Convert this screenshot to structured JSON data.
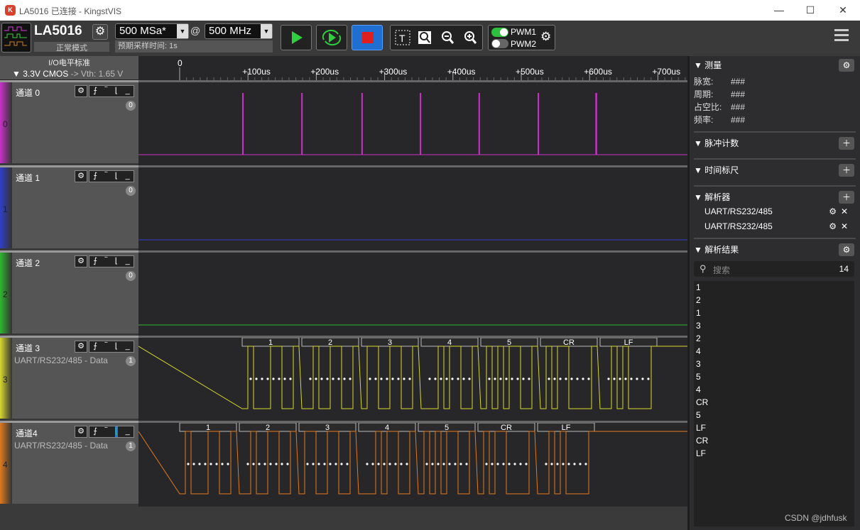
{
  "window": {
    "title": "LA5016 已连接 - KingstVIS",
    "logo": "K",
    "minimize": "—",
    "maximize": "☐",
    "close": "✕"
  },
  "toolbar": {
    "device": "LA5016",
    "mode": "正常模式",
    "sample_rate": "500 MSa*",
    "at": "@",
    "freq": "500 MHz",
    "est_time": "预期采样时间: 1s",
    "pwm1": "PWM1",
    "pwm2": "PWM2"
  },
  "io": {
    "title": "I/O电平标准",
    "level": "3.3V CMOS",
    "vth": "-> Vth: 1.65 V"
  },
  "channels": [
    {
      "num": "0",
      "name": "通道 0",
      "sub": "",
      "count": "0",
      "color": "#c932c9"
    },
    {
      "num": "1",
      "name": "通道 1",
      "sub": "",
      "count": "0",
      "color": "#2f3fc9"
    },
    {
      "num": "2",
      "name": "通道 2",
      "sub": "",
      "count": "0",
      "color": "#2fb82f"
    },
    {
      "num": "3",
      "name": "通道 3",
      "sub": "UART/RS232/485 - Data",
      "count": "1",
      "color": "#d8d82f"
    },
    {
      "num": "4",
      "name": "通道4",
      "sub": "UART/RS232/485 - Data",
      "count": "1",
      "color": "#e07a1e"
    }
  ],
  "ruler": [
    "0",
    "+100us",
    "+200us",
    "+300us",
    "+400us",
    "+500us",
    "+600us",
    "+700us"
  ],
  "decode3": [
    "1",
    "2",
    "3",
    "4",
    "5",
    "CR",
    "LF"
  ],
  "decode4": [
    "1",
    "2",
    "3",
    "4",
    "5",
    "CR",
    "LF"
  ],
  "right": {
    "measure": "测量",
    "width": "脉宽:",
    "period": "周期:",
    "duty": "占空比:",
    "freq": "频率:",
    "hash": "###",
    "pulse": "脉冲计数",
    "timeruler": "时间标尺",
    "analyzer": "解析器",
    "an1": "UART/RS232/485",
    "an2": "UART/RS232/485",
    "results": "解析结果",
    "search": "搜索",
    "result_count": "14",
    "list": [
      "1",
      "2",
      "1",
      "3",
      "2",
      "4",
      "3",
      "5",
      "4",
      "CR",
      "5",
      "LF",
      "CR",
      "LF"
    ]
  },
  "watermark": "CSDN @jdhfusk"
}
